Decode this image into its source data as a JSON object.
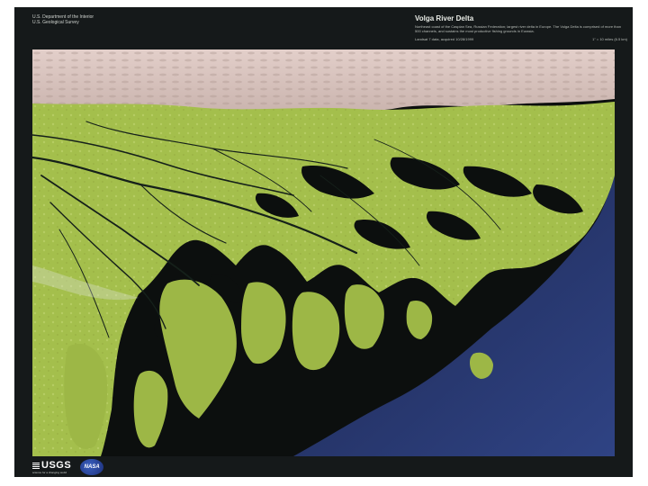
{
  "header": {
    "agency_line1": "U.S. Department of the Interior",
    "agency_line2": "U.S. Geological Survey",
    "title": "Volga River Delta",
    "description": "Northeast coast of the Caspian Sea, Russian Federation; largest river delta in Europe. The Volga Delta is comprised of more than 500 channels, and sustains the most productive fishing grounds in Eurasia.",
    "image_source": "Landsat 7 data, acquired 10/28/1999",
    "scale": "1\" = 10 miles (6.5 km)"
  },
  "logos": {
    "usgs_label": "USGS",
    "usgs_tagline": "science for a changing world",
    "nasa_label": "NASA"
  },
  "colors": {
    "background": "#15191a",
    "vegetation": "#a7c24f",
    "water": "#2a3a72",
    "desert": "#d9c2bd"
  }
}
